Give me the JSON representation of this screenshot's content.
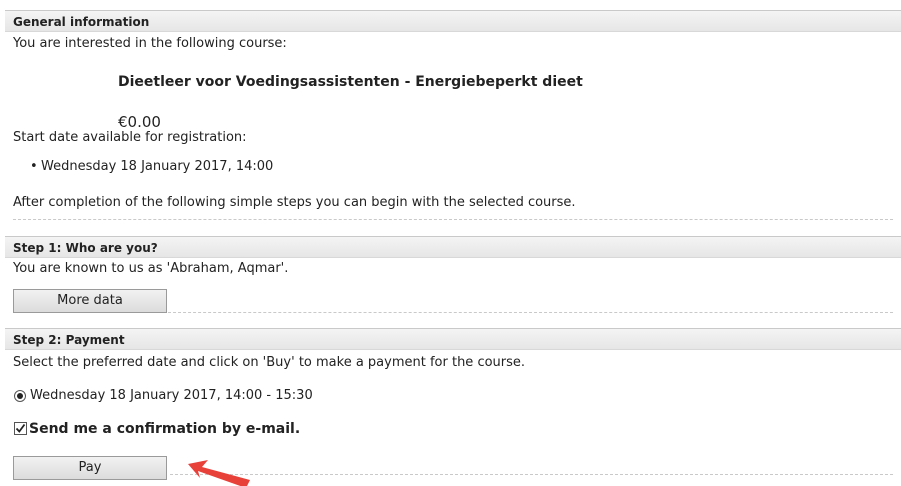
{
  "general": {
    "title": "General information",
    "intro": "You are interested in the following course:",
    "course_name": "Dieetleer voor Voedingsassistenten - Energiebeperkt dieet",
    "price": "€0.00",
    "start_label": "Start date available for registration:",
    "start_dates": [
      "Wednesday 18 January 2017, 14:00"
    ],
    "completion_text": "After completion of the following simple steps you can begin with the selected course."
  },
  "step1": {
    "title": "Step 1: Who are you?",
    "known_as": "You are known to us as 'Abraham, Aqmar'.",
    "more_data_label": "More data"
  },
  "step2": {
    "title": "Step 2: Payment",
    "instructions": "Select the preferred date and click on 'Buy' to make a payment for the course.",
    "date_option": "Wednesday 18 January 2017, 14:00 - 15:30",
    "confirmation_label": "Send me a confirmation by e-mail.",
    "pay_label": "Pay"
  },
  "colors": {
    "arrow": "#e8413a",
    "header_bg": "#ececec"
  }
}
